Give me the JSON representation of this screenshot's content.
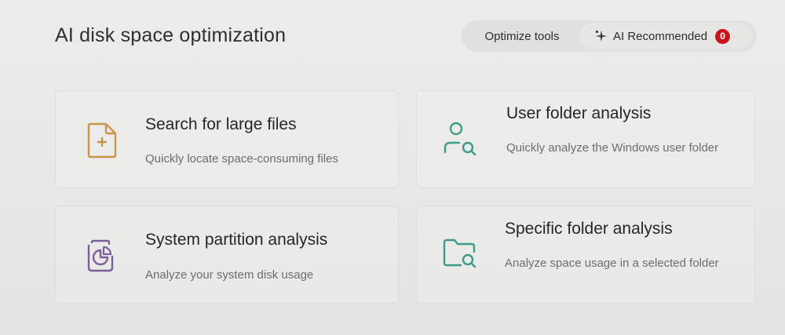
{
  "header": {
    "title": "AI disk space optimization"
  },
  "tabs": {
    "optimize_label": "Optimize tools",
    "ai_label": "AI Recommended",
    "ai_badge": "0"
  },
  "cards": [
    {
      "title": "Search for large files",
      "desc": "Quickly locate space-consuming files",
      "icon": "file-plus-icon",
      "color": "#c9944c"
    },
    {
      "title": "User folder analysis",
      "desc": "Quickly analyze the Windows user folder",
      "icon": "user-search-icon",
      "color": "#3f9a8a"
    },
    {
      "title": "System partition analysis",
      "desc": "Analyze your system disk usage",
      "icon": "disk-pie-icon",
      "color": "#7b5f99"
    },
    {
      "title": "Specific folder analysis",
      "desc": "Analyze space usage in a selected folder",
      "icon": "folder-search-icon",
      "color": "#3f9a8a"
    }
  ]
}
